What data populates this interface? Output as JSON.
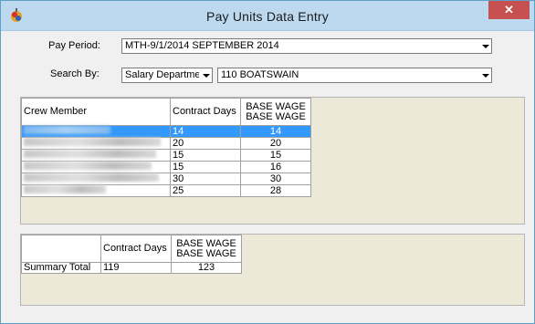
{
  "window": {
    "title": "Pay Units Data Entry",
    "close_label": "✕"
  },
  "filters": {
    "pay_period_label": "Pay Period:",
    "pay_period_value": "MTH-9/1/2014  SEPTEMBER 2014",
    "search_by_label": "Search By:",
    "search_by_value": "Salary Department",
    "department_value": "110 BOATSWAIN"
  },
  "crew_table": {
    "headers": {
      "crew_member": "Crew Member",
      "contract_days": "Contract Days",
      "base_wage_1": "BASE WAGE",
      "base_wage_2": "BASE WAGE"
    },
    "rows": [
      {
        "contract_days": "14",
        "base_wage": "14"
      },
      {
        "contract_days": "20",
        "base_wage": "20"
      },
      {
        "contract_days": "15",
        "base_wage": "15"
      },
      {
        "contract_days": "15",
        "base_wage": "16"
      },
      {
        "contract_days": "30",
        "base_wage": "30"
      },
      {
        "contract_days": "25",
        "base_wage": "28"
      }
    ]
  },
  "summary_table": {
    "headers": {
      "contract_days": "Contract Days",
      "base_wage_1": "BASE WAGE",
      "base_wage_2": "BASE WAGE"
    },
    "row": {
      "label": "Summary Total",
      "contract_days": "119",
      "base_wage": "123"
    }
  },
  "colors": {
    "selection": "#3399ff",
    "close": "#c75050",
    "titlebar": "#bcd9f0"
  }
}
